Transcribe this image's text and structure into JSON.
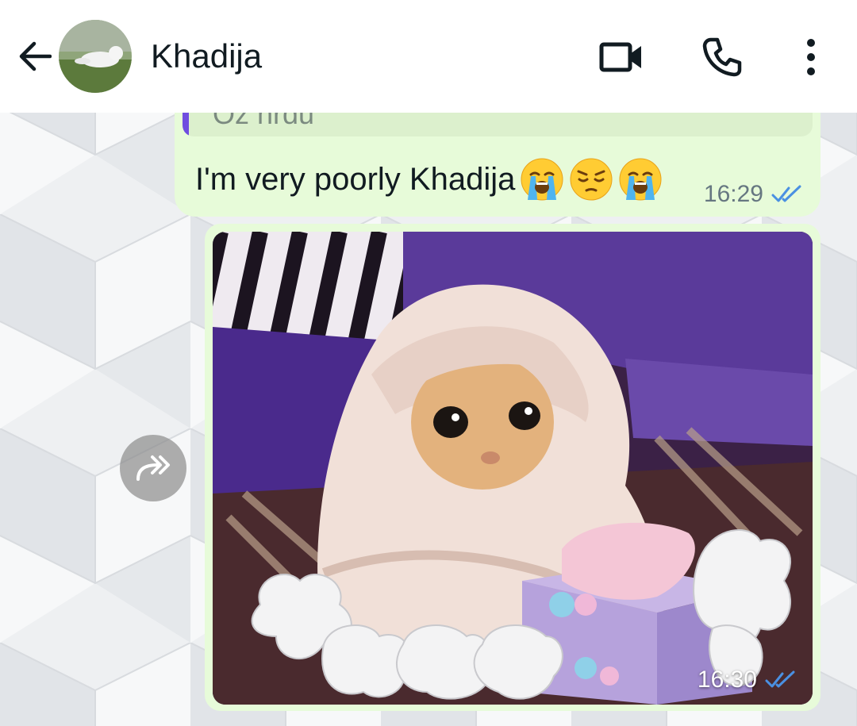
{
  "header": {
    "contact_name": "Khadija",
    "back_icon": "arrow-left-icon",
    "avatar": "contact-avatar-cat",
    "video_icon": "video-camera-icon",
    "call_icon": "phone-icon",
    "menu_icon": "more-vertical-icon"
  },
  "messages": [
    {
      "type": "text",
      "direction": "outgoing",
      "quoted_text_partial": "Oz hrdu",
      "text": "I'm very poorly Khadija",
      "emojis": [
        "loudly-crying-face",
        "pensive-face",
        "loudly-crying-face"
      ],
      "time": "16:29",
      "status": "read"
    },
    {
      "type": "image",
      "direction": "outgoing",
      "image_description": "cat wrapped in towel with tissues",
      "time": "16:30",
      "status": "read"
    }
  ],
  "forward_icon": "forward-icon",
  "colors": {
    "header_bg": "#ffffff",
    "outgoing_bubble": "#e7fbd9",
    "read_tick": "#4a90e2",
    "quote_bar": "#6f4de0"
  }
}
